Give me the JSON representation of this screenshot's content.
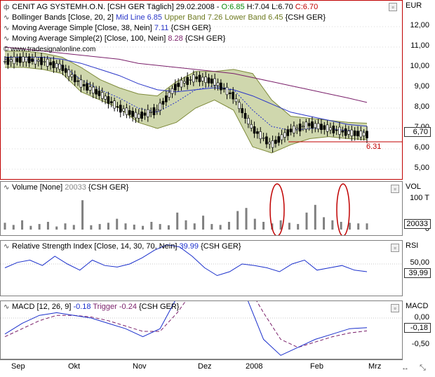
{
  "main_pane": {
    "legend": {
      "line1": {
        "name": "CENIT AG SYSTEMH.O.N. [CSH GER  Täglich] 29.02.2008 -",
        "o": "O:6.85",
        "h": "H:7.04",
        "l": "L:6.70",
        "c": "C:6.70"
      },
      "line2": {
        "name": "Bollinger Bands [Close, 20, 2]",
        "mid": "Mid Line 6.85",
        "upper": "Upper Band 7.26",
        "lower": "Lower Band 6.45",
        "src": "{CSH GER}"
      },
      "line3": {
        "name": "Moving Average Simple [Close, 38, Nein]",
        "val": "7.11",
        "src": "{CSH GER}"
      },
      "line4": {
        "name": "Moving Average Simple(2) [Close, 100, Nein]",
        "val": "8.28",
        "src": "{CSH GER}"
      },
      "watermark": "© www.tradesignalonline.com"
    },
    "axis_label": "EUR",
    "y_ticks": [
      "12,00",
      "11,00",
      "10,00",
      "9,00",
      "8,00",
      "7,00",
      "6,00",
      "5,00"
    ],
    "price_box": "6,70",
    "support_label": "6.31"
  },
  "volume_pane": {
    "legend": {
      "name": "Volume [None]",
      "val": "20033",
      "src": "{CSH GER}"
    },
    "axis_label": "VOL",
    "y_ticks": [
      "100 T",
      "0"
    ],
    "value_box": "20033"
  },
  "rsi_pane": {
    "legend": {
      "name": "Relative Strength Index [Close, 14, 30, 70, Nein]",
      "val": "39.99",
      "src": "{CSH GER}"
    },
    "axis_label": "RSI",
    "y_ticks": [
      "50,00"
    ],
    "value_box": "39,99"
  },
  "macd_pane": {
    "legend": {
      "name": "MACD [12, 26, 9]",
      "val": "-0.18",
      "trigger": "Trigger -0.24",
      "src": "{CSH GER}"
    },
    "axis_label": "MACD",
    "y_ticks": [
      "0,00",
      "-0,50"
    ],
    "value_box": "-0,18"
  },
  "x_labels": [
    "Sep",
    "Okt",
    "Nov",
    "Dez",
    "2008",
    "Feb",
    "Mrz"
  ],
  "colors": {
    "price_frame": "#c00000",
    "bollinger_fill": "#c9d2a6",
    "bollinger_band": "#7e8a3a",
    "ma38": "#2a36c8",
    "ma100": "#7a1f6a",
    "rsi_line": "#1a2fcc",
    "macd_line": "#1a2fcc",
    "trigger_line": "#7a1f6a",
    "highlight": "#c00000"
  },
  "chart_data": {
    "type": "line",
    "title": "CENIT AG SYSTEMH.O.N.",
    "ylim": [
      4.6,
      12.8
    ],
    "x": [
      "Sep",
      "Okt",
      "Nov",
      "Dez",
      "2008",
      "Feb",
      "Mrz"
    ],
    "series": [
      {
        "name": "Close",
        "values": [
          10.3,
          10.4,
          10.3,
          10.0,
          9.2,
          8.7,
          8.0,
          7.6,
          7.9,
          9.1,
          9.5,
          9.3,
          8.6,
          7.0,
          6.2,
          6.9,
          7.2,
          7.0,
          6.8,
          6.7
        ]
      },
      {
        "name": "Mid Line",
        "values": [
          10.4,
          10.4,
          10.3,
          10.1,
          9.4,
          8.9,
          8.5,
          8.0,
          7.8,
          8.3,
          8.9,
          9.1,
          8.9,
          7.9,
          7.1,
          6.9,
          7.0,
          7.0,
          6.9,
          6.85
        ]
      },
      {
        "name": "Upper Band",
        "values": [
          10.8,
          10.8,
          10.7,
          10.5,
          10.0,
          9.4,
          9.0,
          8.7,
          8.6,
          9.3,
          9.8,
          9.8,
          9.9,
          9.7,
          8.4,
          7.6,
          7.5,
          7.4,
          7.3,
          7.26
        ]
      },
      {
        "name": "Lower Band",
        "values": [
          10.0,
          10.0,
          9.9,
          9.7,
          8.8,
          8.4,
          8.0,
          7.3,
          7.0,
          7.3,
          8.0,
          8.4,
          7.9,
          6.1,
          5.8,
          6.2,
          6.5,
          6.6,
          6.5,
          6.45
        ]
      },
      {
        "name": "Moving Average Simple",
        "values": [
          10.5,
          10.5,
          10.5,
          10.4,
          10.2,
          9.9,
          9.6,
          9.2,
          8.9,
          8.8,
          8.9,
          9.0,
          8.9,
          8.6,
          8.2,
          7.8,
          7.6,
          7.4,
          7.2,
          7.11
        ]
      },
      {
        "name": "Moving Average Simple(2)",
        "values": [
          11.0,
          10.9,
          10.8,
          10.7,
          10.6,
          10.5,
          10.4,
          10.2,
          10.1,
          10.0,
          9.9,
          9.8,
          9.7,
          9.5,
          9.3,
          9.1,
          8.9,
          8.7,
          8.5,
          8.28
        ]
      }
    ],
    "volume": {
      "values": [
        22,
        15,
        30,
        12,
        18,
        25,
        10,
        20,
        15,
        95,
        14,
        18,
        22,
        35,
        20,
        16,
        12,
        25,
        18,
        14,
        55,
        30,
        20,
        45,
        18,
        15,
        25,
        60,
        70,
        35,
        25,
        20,
        30,
        22,
        18,
        55,
        80,
        40,
        30,
        25,
        22,
        20,
        20
      ]
    },
    "rsi": {
      "values": [
        45,
        52,
        55,
        48,
        60,
        50,
        42,
        55,
        48,
        46,
        50,
        58,
        68,
        75,
        72,
        60,
        45,
        35,
        40,
        50,
        48,
        45,
        40,
        50,
        55,
        42,
        45,
        48,
        42,
        40
      ]
    },
    "macd": {
      "line": [
        -0.3,
        -0.1,
        0.05,
        0.1,
        0.05,
        0.0,
        -0.1,
        -0.2,
        -0.35,
        -0.2,
        0.4,
        0.85,
        1.0,
        0.85,
        0.4,
        -0.4,
        -0.7,
        -0.55,
        -0.4,
        -0.3,
        -0.2,
        -0.18
      ],
      "trigger": [
        -0.35,
        -0.2,
        -0.05,
        0.05,
        0.05,
        0.02,
        -0.05,
        -0.15,
        -0.25,
        -0.25,
        0.1,
        0.55,
        0.85,
        0.9,
        0.65,
        0.1,
        -0.4,
        -0.55,
        -0.45,
        -0.35,
        -0.28,
        -0.24
      ]
    }
  }
}
